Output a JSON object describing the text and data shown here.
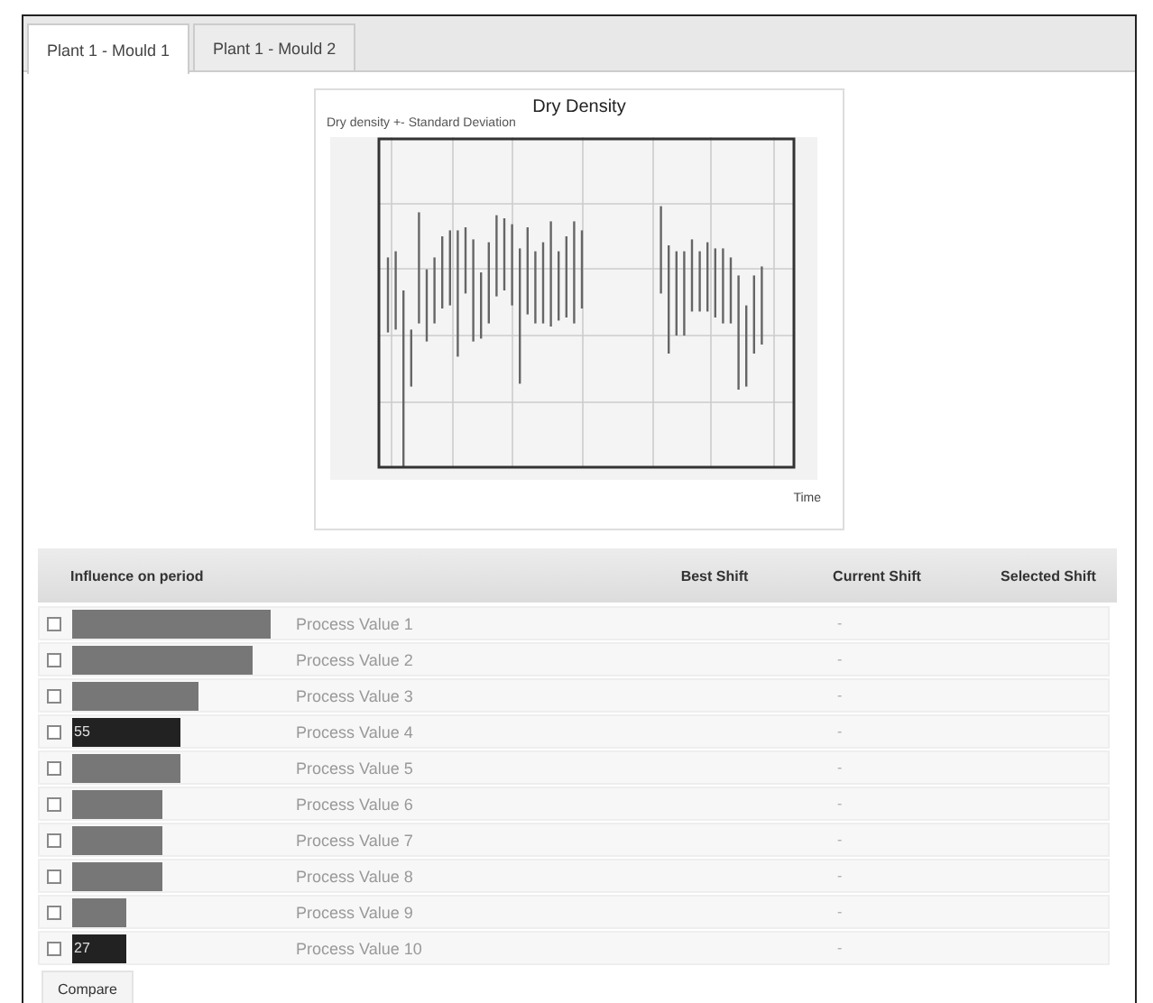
{
  "tabs": [
    {
      "label": "Plant 1 - Mould 1",
      "selected": true
    },
    {
      "label": "Plant 1 - Mould 2",
      "selected": false
    }
  ],
  "chart": {
    "title": "Dry Density",
    "subtitle": "Dry density +- Standard Deviation",
    "xlabel": "Time"
  },
  "table": {
    "columns": [
      "Influence on period",
      "Best Shift",
      "Current Shift",
      "Selected Shift"
    ],
    "rows": [
      {
        "checked": false,
        "highlighted": false,
        "name": "Process Value 1",
        "shift": "-"
      },
      {
        "checked": false,
        "highlighted": false,
        "name": "Process Value 2",
        "shift": "-"
      },
      {
        "checked": false,
        "highlighted": false,
        "name": "Process Value 3",
        "shift": "-"
      },
      {
        "checked": false,
        "highlighted": true,
        "value": "55",
        "name": "Process Value 4",
        "shift": "-"
      },
      {
        "checked": false,
        "highlighted": false,
        "name": "Process Value 5",
        "shift": "-"
      },
      {
        "checked": false,
        "highlighted": false,
        "name": "Process Value 6",
        "shift": "-"
      },
      {
        "checked": false,
        "highlighted": false,
        "name": "Process Value 7",
        "shift": "-"
      },
      {
        "checked": false,
        "highlighted": false,
        "name": "Process Value 8",
        "shift": "-"
      },
      {
        "checked": false,
        "highlighted": false,
        "name": "Process Value 9",
        "shift": "-"
      },
      {
        "checked": false,
        "highlighted": true,
        "value": "27",
        "name": "Process Value 10",
        "shift": "-"
      }
    ]
  },
  "buttons": [
    "Compare"
  ]
}
